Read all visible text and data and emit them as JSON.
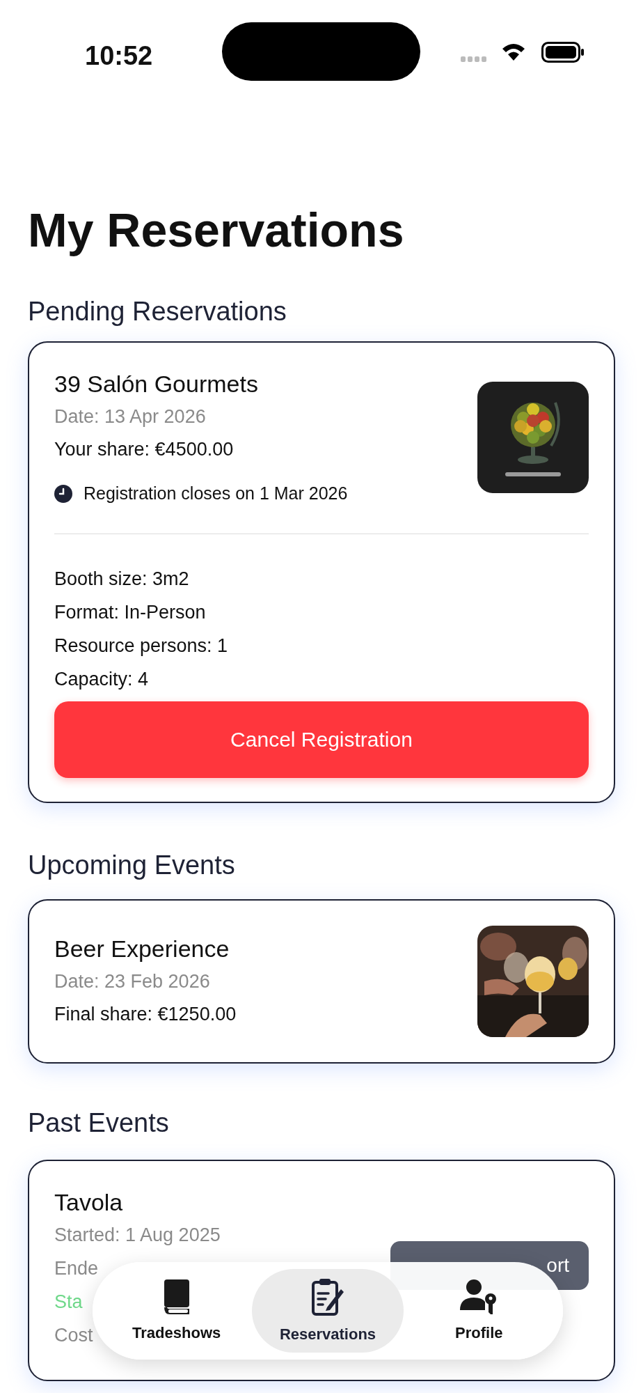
{
  "status_bar": {
    "time": "10:52"
  },
  "title": "My Reservations",
  "pending": {
    "heading": "Pending Reservations",
    "card": {
      "name": "39 Salón Gourmets",
      "date": "Date: 13 Apr 2026",
      "share": "Your share: €4500.00",
      "deadline": "Registration closes on 1 Mar 2026",
      "details": [
        "Booth size: 3m2",
        "Format: In-Person",
        "Resource persons: 1",
        "Capacity: 4"
      ],
      "button": "Cancel Registration"
    }
  },
  "upcoming": {
    "heading": "Upcoming Events",
    "card": {
      "name": "Beer Experience",
      "date": "Date: 23 Feb 2026",
      "share": "Final share: €1250.00"
    }
  },
  "past": {
    "heading": "Past Events",
    "card": {
      "name": "Tavola",
      "started": "Started: 1 Aug 2025",
      "ended": "Ende",
      "status": "Sta",
      "cost": "Cost",
      "button": "ort"
    }
  },
  "tab_bar": [
    {
      "label": "Tradeshows",
      "kind": "book",
      "selected": false
    },
    {
      "label": "Reservations",
      "kind": "clipboard",
      "selected": true
    },
    {
      "label": "Profile",
      "kind": "person",
      "selected": false
    }
  ]
}
